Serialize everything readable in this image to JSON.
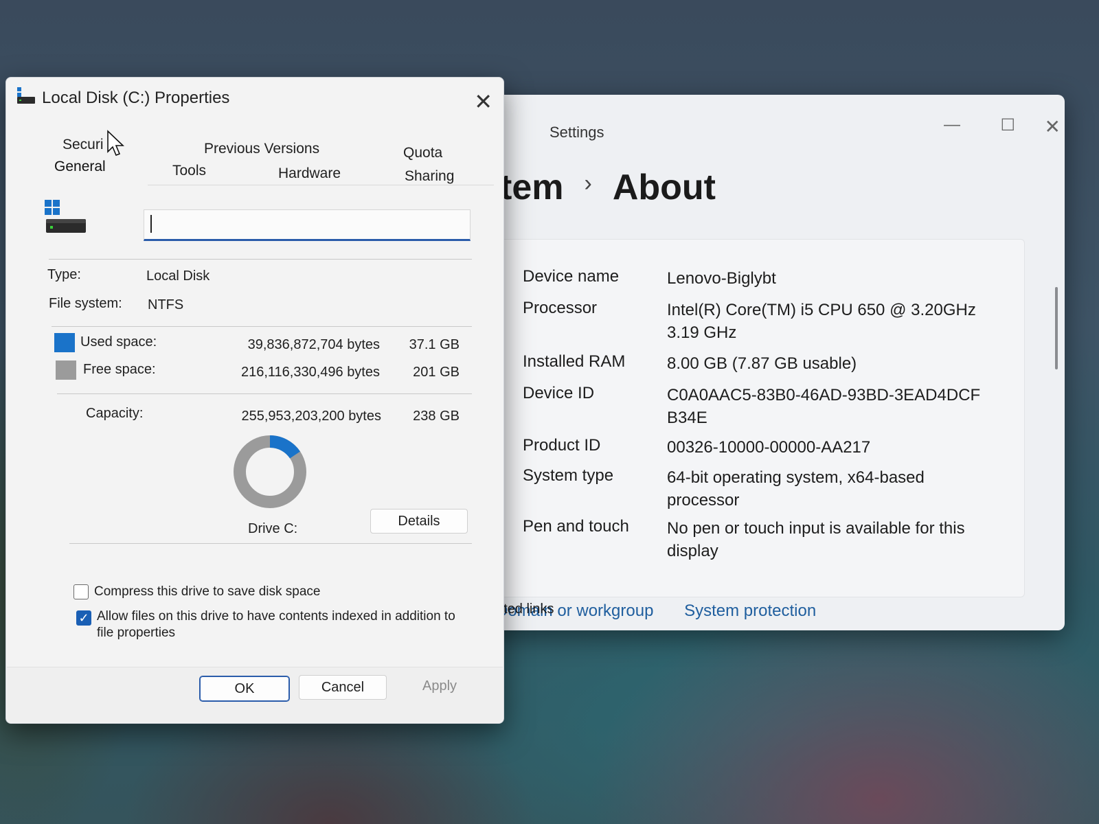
{
  "settings": {
    "app_title": "Settings",
    "menu_icon": "hamburger-menu-icon",
    "breadcrumb": {
      "parent": "tem",
      "separator": "›",
      "current": "About"
    },
    "window_controls": {
      "minimize": "—",
      "maximize": "☐",
      "close": "✕"
    },
    "specs": [
      {
        "key": "Device name",
        "value": "Lenovo-Biglybt"
      },
      {
        "key": "Processor",
        "value": "Intel(R) Core(TM) i5 CPU       650  @ 3.20GHz   3.19 GHz"
      },
      {
        "key": "Installed RAM",
        "value": "8.00 GB (7.87 GB usable)"
      },
      {
        "key": "Device ID",
        "value": "C0A0AAC5-83B0-46AD-93BD-3EAD4DCF B34E"
      },
      {
        "key": "Product ID",
        "value": "00326-10000-00000-AA217"
      },
      {
        "key": "System type",
        "value": "64-bit operating system, x64-based processor"
      },
      {
        "key": "Pen and touch",
        "value": "No pen or touch input is available for this display"
      }
    ],
    "related_links": {
      "label": "ated links",
      "links": [
        "Domain or workgroup",
        "System protection"
      ]
    }
  },
  "properties": {
    "title": "Local Disk (C:) Properties",
    "close": "✕",
    "tabs_row1": [
      "Securi",
      "Previous Versions",
      "Quota"
    ],
    "tabs_row2": [
      "General",
      "Tools",
      "Hardware",
      "Sharing"
    ],
    "active_tab": "General",
    "drive_name_value": "",
    "type_label": "Type:",
    "type_value": "Local Disk",
    "fs_label": "File system:",
    "fs_value": "NTFS",
    "used": {
      "label": "Used space:",
      "bytes": "39,836,872,704 bytes",
      "size": "37.1 GB",
      "color": "#1a73c9"
    },
    "free": {
      "label": "Free space:",
      "bytes": "216,116,330,496 bytes",
      "size": "201 GB",
      "color": "#9b9b9b"
    },
    "capacity": {
      "label": "Capacity:",
      "bytes": "255,953,203,200 bytes",
      "size": "238 GB"
    },
    "used_fraction": 0.1556,
    "drive_label": "Drive C:",
    "details_button": "Details",
    "compress_label": "Compress this drive to save disk space",
    "compress_checked": false,
    "index_label_1": "Allow files on this drive to have contents indexed in addition to",
    "index_label_2": "file properties",
    "index_checked": true,
    "buttons": {
      "ok": "OK",
      "cancel": "Cancel",
      "apply": "Apply"
    }
  }
}
